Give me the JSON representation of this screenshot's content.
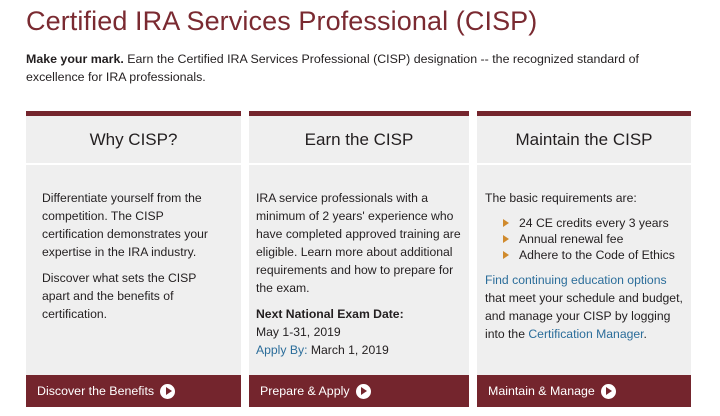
{
  "page": {
    "title": "Certified IRA Services Professional (CISP)",
    "intro_lead": "Make your mark.",
    "intro_text": " Earn the Certified IRA Services Professional (CISP) designation -- the recognized standard of excellence for IRA professionals."
  },
  "colors": {
    "title": "#7a2a31",
    "accent": "#74252d",
    "card_bg": "#efefef",
    "link": "#2b6d9a",
    "bullet": "#d08a2c"
  },
  "cards": [
    {
      "heading": "Why CISP?",
      "para1": "Differentiate yourself from the competition. The CISP certification demonstrates your expertise in the IRA industry.",
      "para2": "Discover what sets the CISP apart and the benefits of certification.",
      "button": "Discover the Benefits",
      "button_icon": "arrow-circle-right-icon"
    },
    {
      "heading": "Earn the CISP",
      "para1": "IRA service professionals with a minimum of 2 years' experience who have completed approved training are eligible. Learn more about additional requirements and how to prepare for the exam.",
      "exam_label": "Next National Exam Date:",
      "exam_dates": "May 1-31, 2019",
      "apply_by_label": "Apply By:",
      "apply_by_date": " March 1, 2019",
      "button": "Prepare & Apply",
      "button_icon": "arrow-circle-right-icon"
    },
    {
      "heading": "Maintain the CISP",
      "intro": "The basic requirements are:",
      "requirements": [
        "24 CE credits every 3 years",
        "Annual renewal fee",
        "Adhere to the Code of Ethics"
      ],
      "ce_link": "Find continuing education options",
      "text_mid": " that meet your schedule and budget, and manage your CISP by logging into the ",
      "manager_link": "Certification Manager",
      "text_end": ".",
      "button": "Maintain & Manage",
      "button_icon": "arrow-circle-right-icon"
    }
  ]
}
